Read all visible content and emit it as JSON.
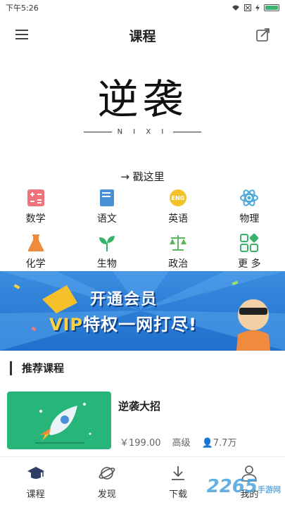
{
  "status": {
    "time": "下午5:26"
  },
  "header": {
    "title": "课程"
  },
  "logo": {
    "glyphs": "逆袭",
    "sub": "N I X I"
  },
  "tagline": "→ 戳这里",
  "categories": [
    {
      "label": "数学",
      "icon": "calculator-icon",
      "color": "#f0727a"
    },
    {
      "label": "语文",
      "icon": "book-icon",
      "color": "#4a90d9"
    },
    {
      "label": "英语",
      "icon": "eng-badge-icon",
      "color": "#f2c22a"
    },
    {
      "label": "物理",
      "icon": "atom-icon",
      "color": "#4aa9d8"
    },
    {
      "label": "化学",
      "icon": "flask-icon",
      "color": "#f08a3c"
    },
    {
      "label": "生物",
      "icon": "leaf-icon",
      "color": "#3ab36a"
    },
    {
      "label": "政治",
      "icon": "scales-icon",
      "color": "#5bb75b"
    },
    {
      "label": "更 多",
      "icon": "grid-more-icon",
      "color": "#3ab36a"
    }
  ],
  "banner": {
    "line1": "开通会员",
    "line2_vip": "VIP",
    "line2_rest": "特权一网打尽!"
  },
  "section": {
    "title": "推荐课程"
  },
  "course": {
    "name": "逆袭大招",
    "price": "￥199.00",
    "level": "高级",
    "views": "7.7万"
  },
  "tabs": [
    {
      "label": "课程",
      "icon": "graduation-cap-icon"
    },
    {
      "label": "发现",
      "icon": "planet-icon"
    },
    {
      "label": "下载",
      "icon": "download-icon"
    },
    {
      "label": "我的",
      "icon": "user-icon"
    }
  ],
  "watermark": {
    "num": "2265",
    "site": "手游网"
  }
}
